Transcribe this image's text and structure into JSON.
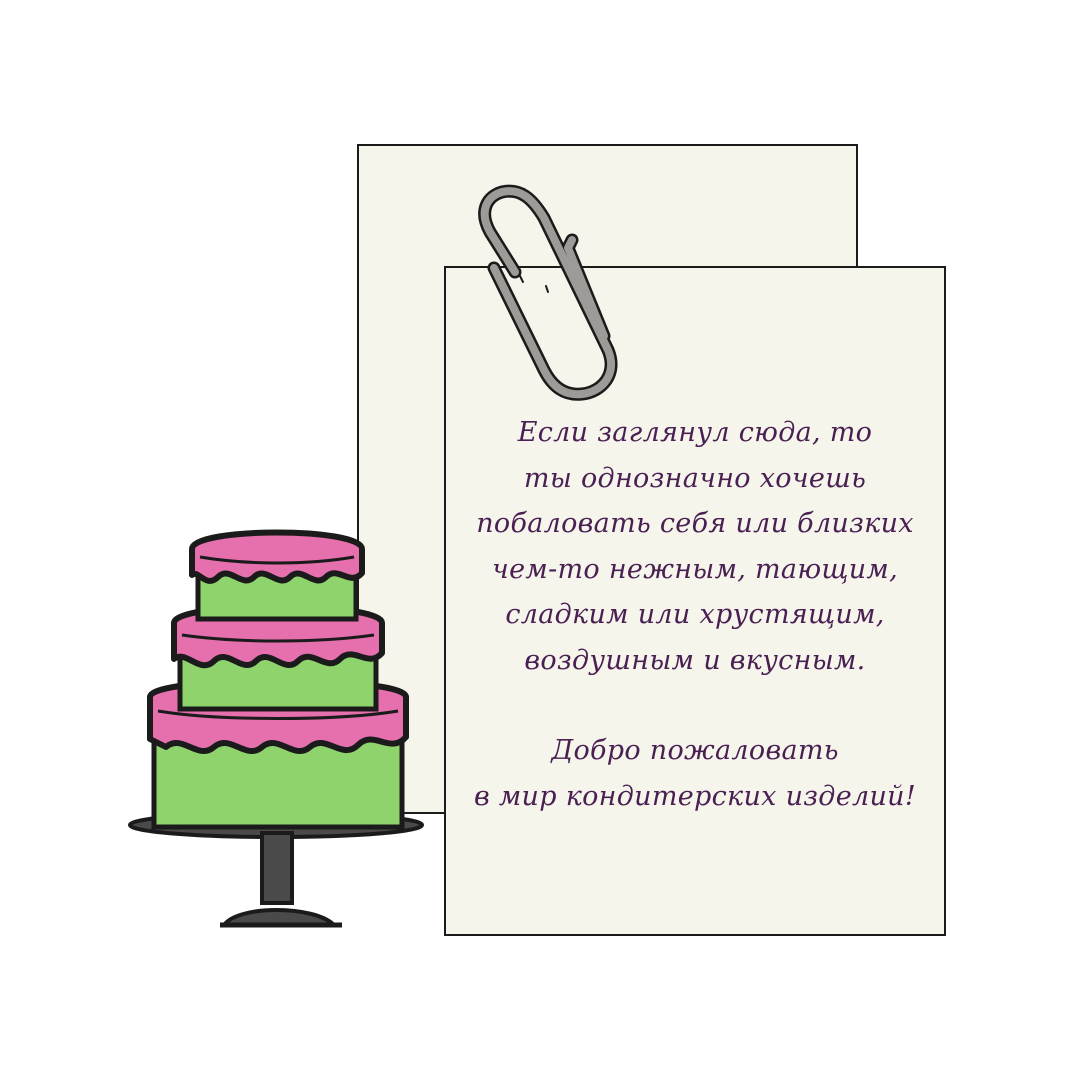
{
  "note": {
    "lines": [
      "Если заглянул сюда, то",
      "ты однозначно хочешь",
      "побаловать себя или близких",
      "чем-то нежным, тающим,",
      "сладким или хрустящим,",
      "воздушным и вкусным."
    ],
    "welcome_lines": [
      "Добро пожаловать",
      "в мир кондитерских изделий!"
    ]
  },
  "colors": {
    "text": "#4a1f52",
    "paper": "#f5f5ec",
    "cake_icing": "#e66fae",
    "cake_body": "#8fd36d",
    "outline": "#1b1b1b",
    "clip": "#9e9a97"
  },
  "icons": {
    "clip": "paperclip-icon",
    "cake": "tiered-cake-icon"
  }
}
